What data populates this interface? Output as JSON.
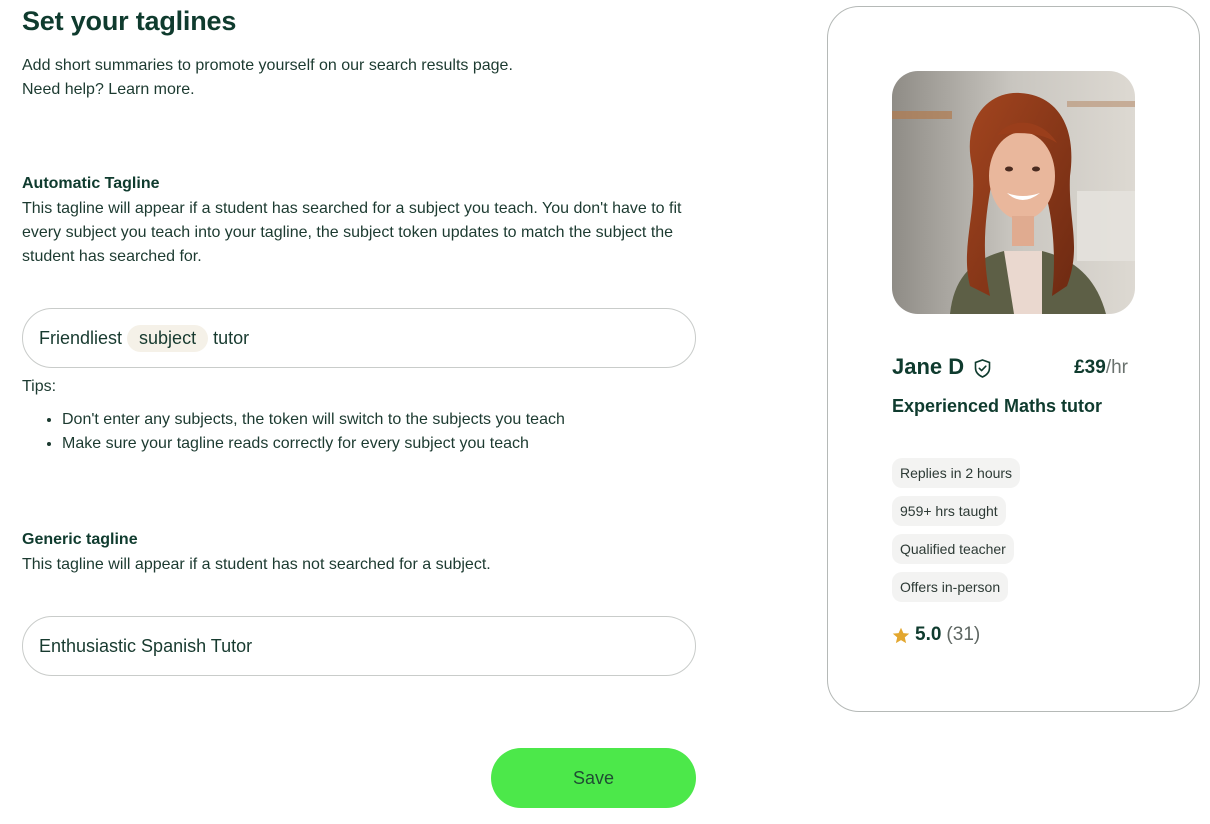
{
  "page": {
    "title": "Set your taglines",
    "intro_line1": "Add short summaries to promote yourself on our search results page.",
    "intro_line2_prefix": "Need help? ",
    "learn_more": "Learn more."
  },
  "automatic": {
    "heading": "Automatic Tagline",
    "description": "This tagline will appear if a student has searched for a subject you teach. You don't have to fit every subject you teach into your tagline, the subject token updates to match the subject the student has searched for.",
    "value_before": "Friendliest",
    "token": "subject",
    "value_after": "tutor"
  },
  "tips": {
    "label": "Tips:",
    "items": [
      "Don't enter any subjects, the token will switch to the subjects you teach",
      "Make sure your tagline reads correctly for every subject you teach"
    ]
  },
  "generic": {
    "heading": "Generic tagline",
    "description": "This tagline will appear if a student has not searched for a subject.",
    "value": "Enthusiastic Spanish Tutor"
  },
  "save_label": "Save",
  "preview": {
    "name": "Jane D",
    "price": "£39",
    "price_unit": "/hr",
    "tagline": "Experienced Maths tutor",
    "badges": [
      "Replies in 2 hours",
      "959+ hrs taught",
      "Qualified teacher",
      "Offers in-person"
    ],
    "rating": "5.0",
    "review_count": "(31)"
  },
  "colors": {
    "primary_text": "#0f3b2e",
    "save_button": "#4ce84a",
    "token_bg": "#f5f1e8",
    "star": "#e3a72f"
  }
}
